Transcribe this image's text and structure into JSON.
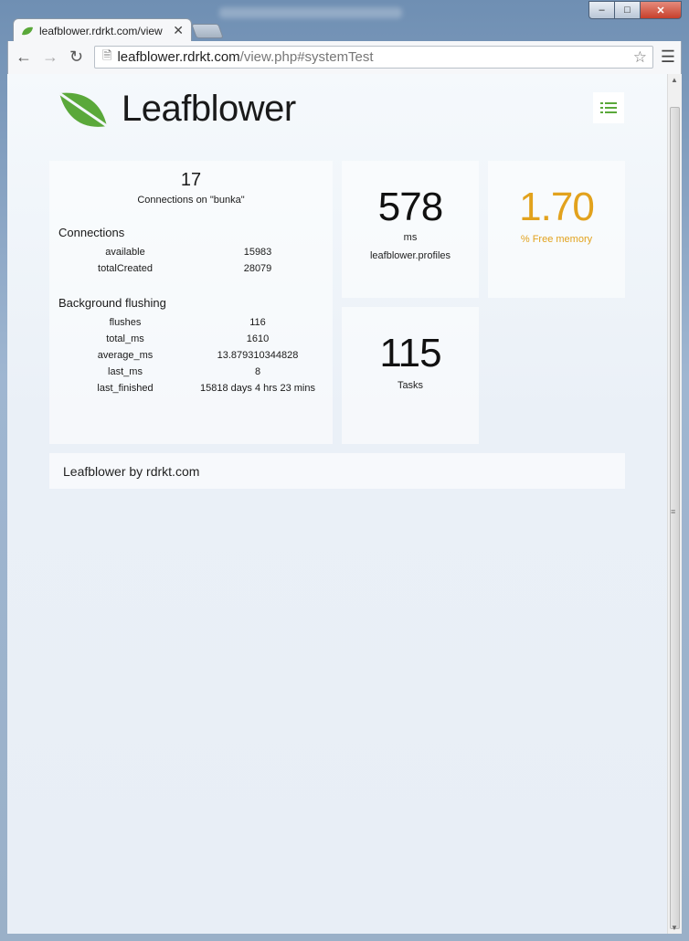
{
  "browser": {
    "tab_title": "leafblower.rdrkt.com/view",
    "url_domain": "leafblower.rdrkt.com",
    "url_path": "/view.php#systemTest"
  },
  "page": {
    "brand": "Leafblower",
    "accent_color": "#5aa83a",
    "highlight_color": "#e2a21d"
  },
  "connections_card": {
    "count": "17",
    "subtitle": "Connections on \"bunka\"",
    "section1_title": "Connections",
    "section1_rows": [
      {
        "key": "available",
        "value": "15983"
      },
      {
        "key": "totalCreated",
        "value": "28079"
      }
    ],
    "section2_title": "Background flushing",
    "section2_rows": [
      {
        "key": "flushes",
        "value": "116"
      },
      {
        "key": "total_ms",
        "value": "1610"
      },
      {
        "key": "average_ms",
        "value": "13.879310344828"
      },
      {
        "key": "last_ms",
        "value": "8"
      },
      {
        "key": "last_finished",
        "value": "15818 days 4 hrs 23 mins"
      }
    ]
  },
  "ms_card": {
    "value": "578",
    "unit": "ms",
    "label": "leafblower.profiles"
  },
  "memory_card": {
    "value": "1.70",
    "label": "% Free memory"
  },
  "tasks_card": {
    "value": "115",
    "label": "Tasks"
  },
  "footer": {
    "text": "Leafblower by rdrkt.com"
  }
}
